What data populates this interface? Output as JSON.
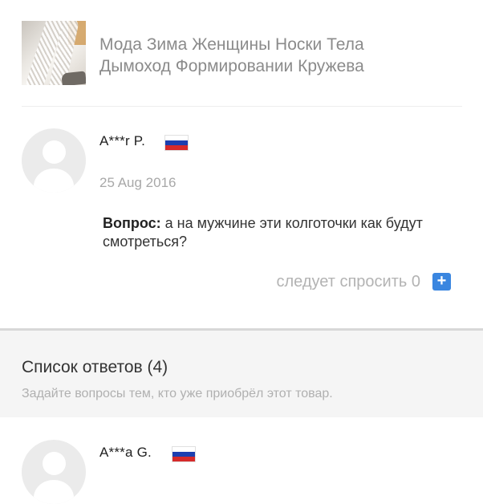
{
  "product": {
    "title_line1": "Мода Зима Женщины Носки Тела",
    "title_line2": "Дымоход Формировании Кружева"
  },
  "question": {
    "user": "A***r P.",
    "country": "Russia",
    "date": "25 Aug 2016",
    "label": "Вопрос:",
    "text": " а на мужчине эти колготочки как будут смотреться?",
    "follow_label": "следует спросить",
    "follow_count": "0",
    "follow_button_icon": "+"
  },
  "answers": {
    "title": "Список ответов (4)",
    "subtitle": "Задайте вопросы тем, кто уже приобрёл этот товар.",
    "items": [
      {
        "user": "A***a G.",
        "country": "Russia"
      }
    ]
  },
  "colors": {
    "accent": "#3a86e0",
    "flag_white": "#ffffff",
    "flag_blue": "#1c3fb0",
    "flag_red": "#d62a2a"
  }
}
